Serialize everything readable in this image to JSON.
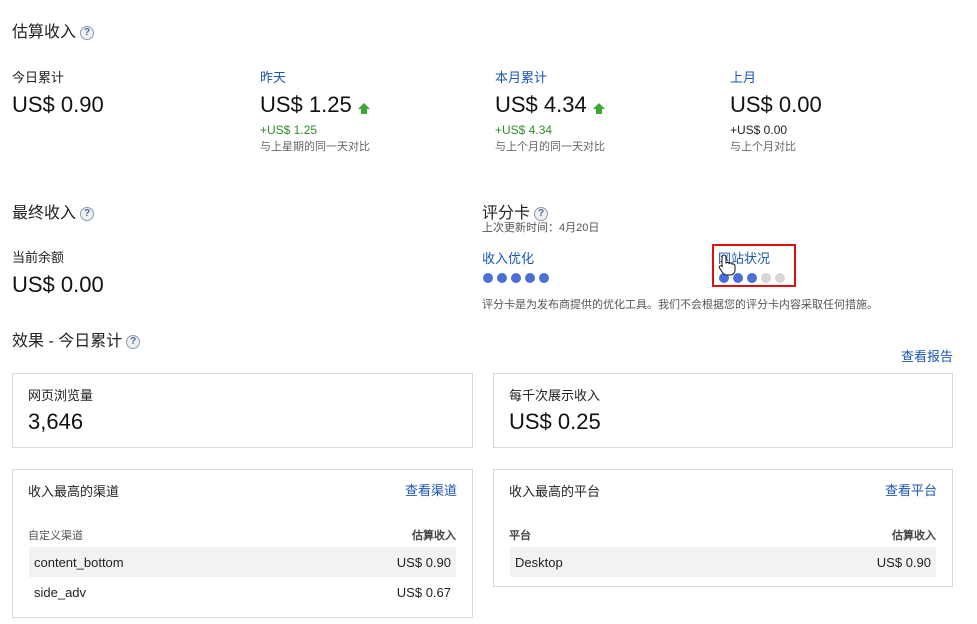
{
  "estimated": {
    "title": "估算收入",
    "today": {
      "label": "今日累计",
      "value": "US$ 0.90"
    },
    "yesterday": {
      "label": "昨天",
      "value": "US$ 1.25",
      "delta": "+US$ 1.25",
      "compare": "与上星期的同一天对比"
    },
    "this_month": {
      "label": "本月累计",
      "value": "US$ 4.34",
      "delta": "+US$ 4.34",
      "compare": "与上个月的同一天对比"
    },
    "last_month": {
      "label": "上月",
      "value": "US$ 0.00",
      "delta": "+US$ 0.00",
      "compare": "与上个月对比"
    }
  },
  "final": {
    "title": "最终收入",
    "balance_label": "当前余额",
    "balance_value": "US$ 0.00"
  },
  "scorecard": {
    "title": "评分卡",
    "updated": "上次更新时间：4月20日",
    "revenue_opt": {
      "label": "收入优化",
      "score": 5,
      "max": 5
    },
    "site_health": {
      "label": "网站状况",
      "score": 3,
      "max": 5
    },
    "note": "评分卡是为发布商提供的优化工具。我们不会根据您的评分卡内容采取任何措施。",
    "colors": {
      "on": "#4a6fd6",
      "off": "#d6d6d6",
      "highlight": "#e01010"
    }
  },
  "performance": {
    "title": "效果 - 今日累计",
    "view_report": "查看报告",
    "page_views": {
      "label": "网页浏览量",
      "value": "3,646"
    },
    "rpm": {
      "label": "每千次展示收入",
      "value": "US$ 0.25"
    }
  },
  "top_channels": {
    "title": "收入最高的渠道",
    "link": "查看渠道",
    "col1": "自定义渠道",
    "col2": "估算收入",
    "rows": [
      {
        "name": "content_bottom",
        "value": "US$ 0.90"
      },
      {
        "name": "side_adv",
        "value": "US$ 0.67"
      }
    ]
  },
  "top_platforms": {
    "title": "收入最高的平台",
    "link": "查看平台",
    "col1": "平台",
    "col2": "估算收入",
    "rows": [
      {
        "name": "Desktop",
        "value": "US$ 0.90"
      }
    ]
  }
}
